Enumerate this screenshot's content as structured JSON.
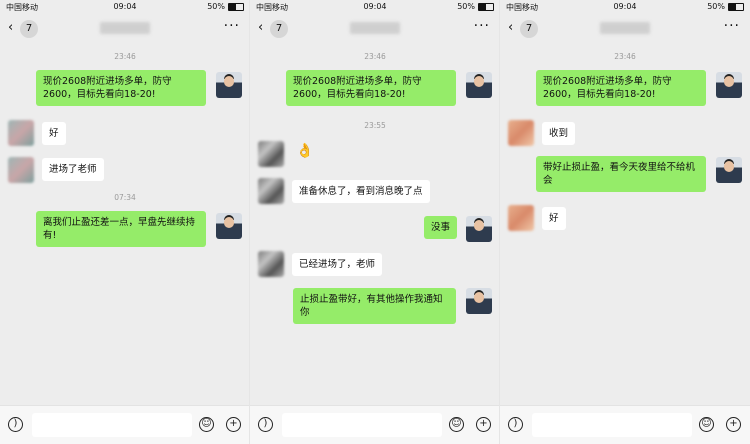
{
  "status": {
    "carrier": "中国移动",
    "time": "09:04",
    "battery": "50%",
    "battery_level": 0.5
  },
  "nav": {
    "unread": "7",
    "more": "···"
  },
  "panels": [
    {
      "timestamps": [
        "23:46",
        "07:34"
      ],
      "messages": [
        "现价2608附近进场多单，防守2600，目标先看向18-20!",
        "好",
        "进场了老师",
        "离我们止盈还差一点，早盘先继续持有!"
      ]
    },
    {
      "timestamps": [
        "23:46",
        "23:55"
      ],
      "messages": [
        "现价2608附近进场多单，防守2600，目标先看向18-20!",
        "👌",
        "准备休息了，看到消息晚了点",
        "没事",
        "已经进场了，老师",
        "止损止盈带好，有其他操作我通知你"
      ]
    },
    {
      "timestamps": [
        "23:46"
      ],
      "messages": [
        "现价2608附近进场多单，防守2600，目标先看向18-20!",
        "收到",
        "带好止损止盈，看今天夜里给不给机会",
        "好"
      ]
    }
  ],
  "icons": {
    "voice": "voice-icon",
    "emoji": "emoji-icon",
    "plus": "plus-icon",
    "back": "back-chevron-icon"
  }
}
